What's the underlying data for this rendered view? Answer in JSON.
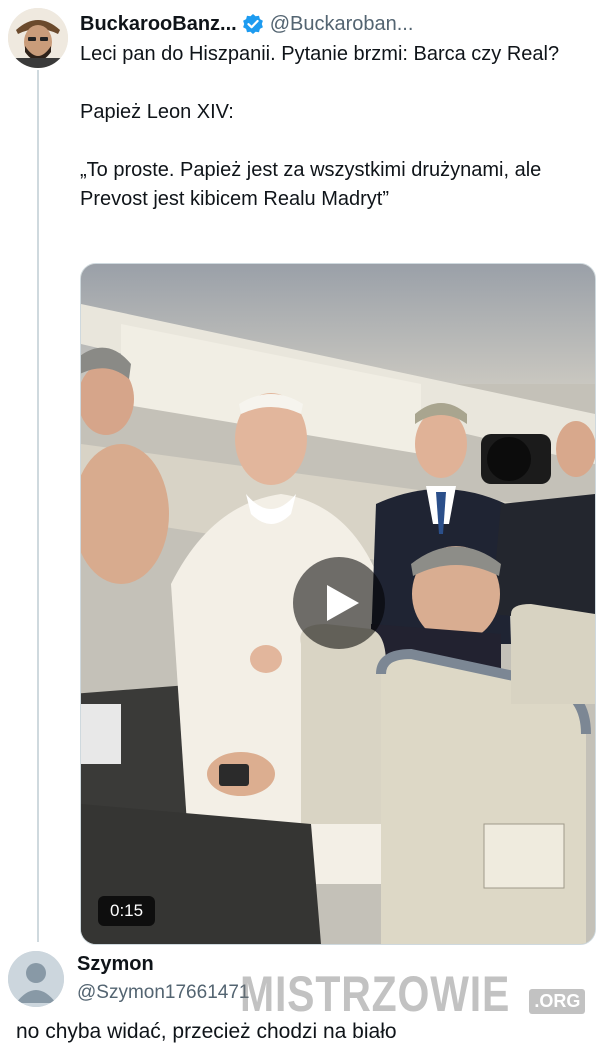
{
  "tweet": {
    "display_name": "BuckarooBanz...",
    "handle": "@Buckaroban...",
    "text": "Leci pan do Hiszpanii. Pytanie brzmi: Barca czy Real?\n\nPapież Leon XIV:\n\n„To proste. Papież jest za wszystkimi drużynami, ale Prevost jest kibicem Realu Madryt”",
    "verified_color": "#1d9bf0",
    "media": {
      "type": "video",
      "duration": "0:15",
      "play_icon": "play-icon"
    }
  },
  "reply": {
    "display_name": "Szymon",
    "handle": "@Szymon17661471",
    "text": "no chyba widać, przecież chodzi na biało"
  },
  "watermark": {
    "text": "MISTRZOWIE",
    "suffix": ".ORG"
  },
  "colors": {
    "text": "#0f1419",
    "secondary": "#536471",
    "thread_line": "#cfd9de"
  }
}
